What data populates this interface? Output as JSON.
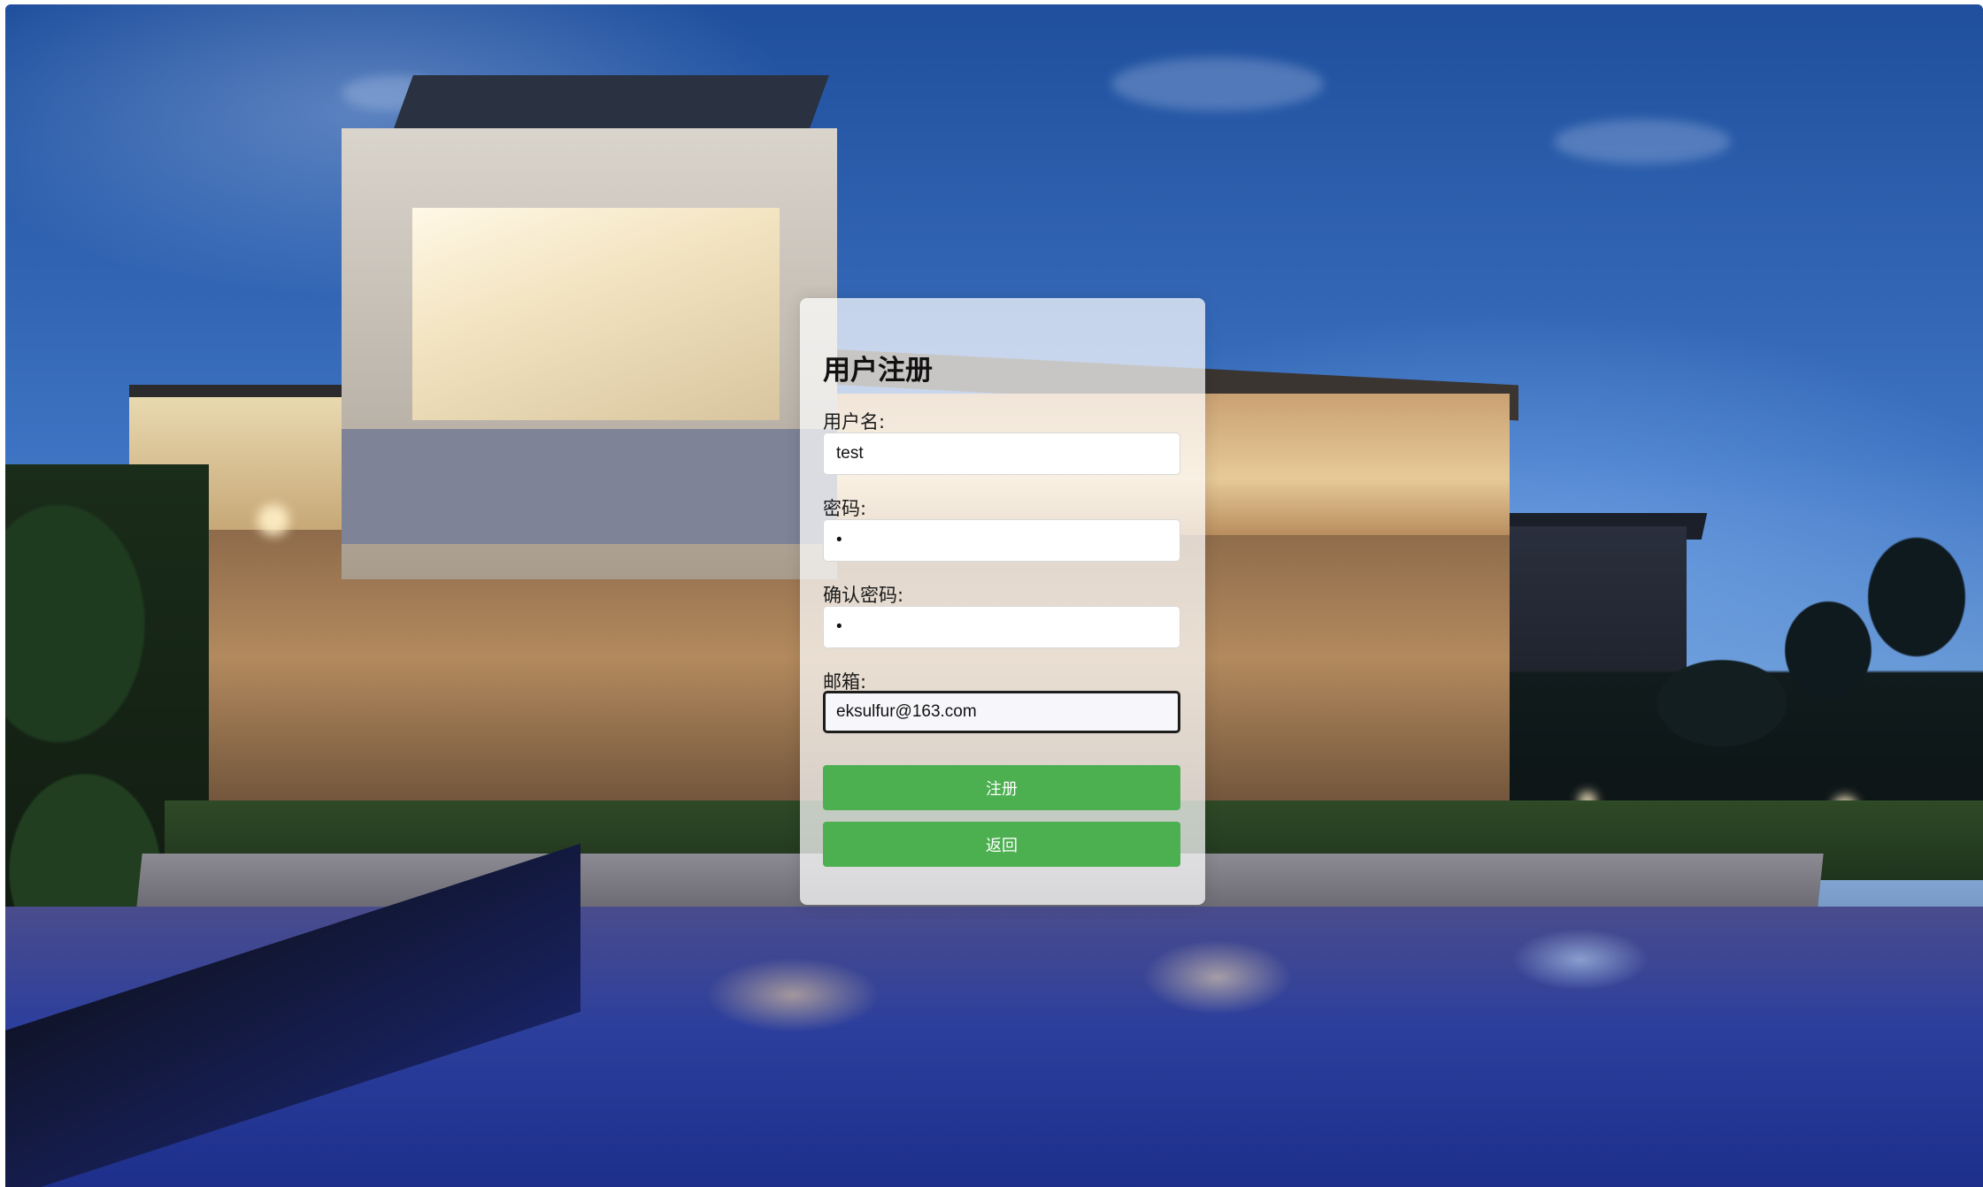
{
  "theme": {
    "button_color": "#4caf50",
    "panel_background": "rgba(255,255,255,0.72)"
  },
  "background": {
    "description_icon": "modern-house-pool-night-photo"
  },
  "form": {
    "title": "用户注册",
    "username": {
      "label": "用户名:",
      "value": "test"
    },
    "password": {
      "label": "密码:",
      "value": "•"
    },
    "confirm_password": {
      "label": "确认密码:",
      "value": "•"
    },
    "email": {
      "label": "邮箱:",
      "value": "eksulfur@163.com"
    },
    "register_button": "注册",
    "back_button": "返回"
  }
}
